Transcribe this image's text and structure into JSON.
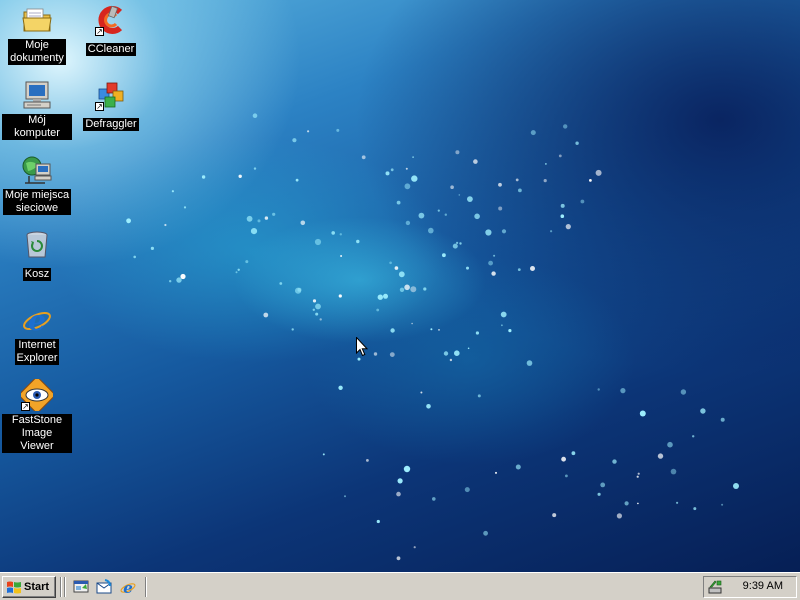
{
  "desktop": {
    "icons": [
      {
        "label": "Moje\ndokumenty",
        "icon": "my-documents-folder-icon"
      },
      {
        "label": "CCleaner",
        "icon": "ccleaner-icon",
        "shortcut": true
      },
      {
        "label": "Mój komputer",
        "icon": "my-computer-icon"
      },
      {
        "label": "Defraggler",
        "icon": "defraggler-icon",
        "shortcut": true
      },
      {
        "label": "Moje miejsca\nsieciowe",
        "icon": "network-places-icon"
      },
      {
        "label": "Kosz",
        "icon": "recycle-bin-icon"
      },
      {
        "label": "Internet\nExplorer",
        "icon": "internet-explorer-icon"
      },
      {
        "label": "FastStone\nImage Viewer",
        "icon": "faststone-image-viewer-icon",
        "shortcut": true
      }
    ]
  },
  "taskbar": {
    "start_label": "Start",
    "quick_launch": [
      "show-desktop-icon",
      "outlook-express-icon",
      "internet-explorer-icon"
    ],
    "clock": "9:39 AM",
    "tray_icons": [
      "safely-remove-hardware-icon"
    ]
  },
  "colors": {
    "taskbar_bg": "#d4d0c8",
    "desktop_dark": "#061f55",
    "desktop_light": "#5fb6e0",
    "label_bg": "#000000",
    "label_text": "#ffffff"
  }
}
